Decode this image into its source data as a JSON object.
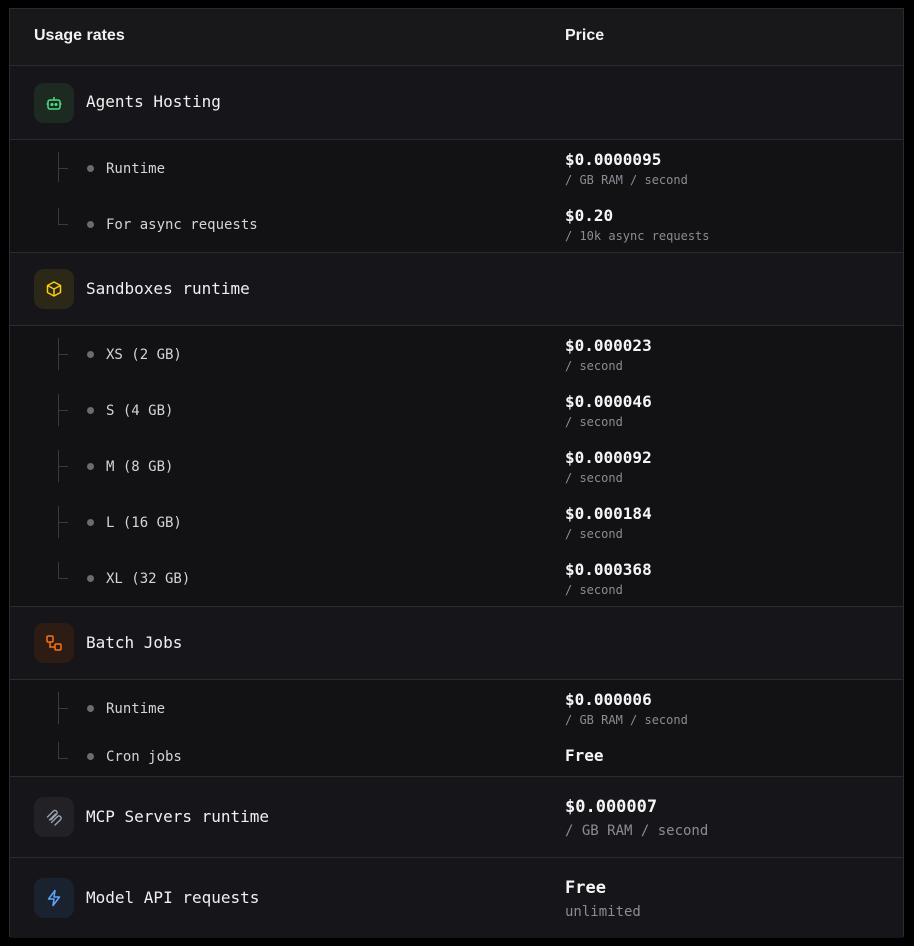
{
  "header": {
    "usage_label": "Usage rates",
    "price_label": "Price"
  },
  "groups": [
    {
      "name": "Agents Hosting",
      "icon": "robot-icon",
      "color": "#4ade80",
      "items": [
        {
          "name": "Runtime",
          "price": "$0.0000095",
          "unit": "/ GB RAM / second"
        },
        {
          "name": "For async requests",
          "price": "$0.20",
          "unit": "/ 10k async requests"
        }
      ]
    },
    {
      "name": "Sandboxes runtime",
      "icon": "cube-icon",
      "color": "#facc15",
      "items": [
        {
          "name": "XS (2 GB)",
          "price": "$0.000023",
          "unit": "/ second"
        },
        {
          "name": "S (4 GB)",
          "price": "$0.000046",
          "unit": "/ second"
        },
        {
          "name": "M (8 GB)",
          "price": "$0.000092",
          "unit": "/ second"
        },
        {
          "name": "L (16 GB)",
          "price": "$0.000184",
          "unit": "/ second"
        },
        {
          "name": "XL (32 GB)",
          "price": "$0.000368",
          "unit": "/ second"
        }
      ]
    },
    {
      "name": "Batch Jobs",
      "icon": "workflow-icon",
      "color": "#f97316",
      "items": [
        {
          "name": "Runtime",
          "price": "$0.000006",
          "unit": "/ GB RAM / second"
        },
        {
          "name": "Cron jobs",
          "price": "Free"
        }
      ]
    },
    {
      "name": "MCP Servers runtime",
      "icon": "mcp-icon",
      "color": "#9ca3af",
      "price": "$0.000007",
      "unit": "/ GB RAM / second"
    },
    {
      "name": "Model API requests",
      "icon": "lightning-icon",
      "color": "#60a5fa",
      "price": "Free",
      "unit": "unlimited"
    }
  ]
}
